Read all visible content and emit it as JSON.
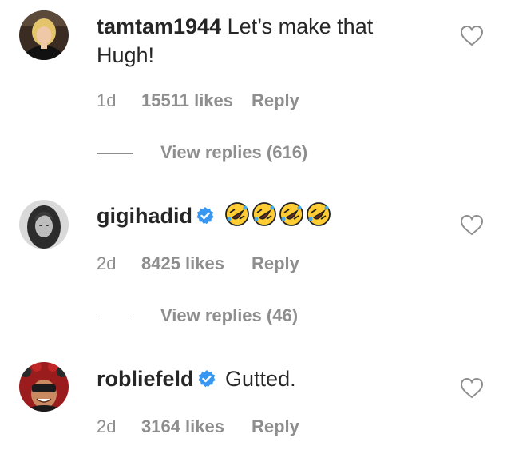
{
  "colors": {
    "text": "#262626",
    "muted": "#8e8e8e",
    "verified": "#3897f0"
  },
  "comments": [
    {
      "username": "tamtam1944",
      "text_line1": "Let’s make that",
      "text_line2": "Hugh!",
      "verified": false,
      "time": "1d",
      "likes": "15511 likes",
      "reply": "Reply",
      "view_replies": "View replies (616)",
      "avatar_icon": "avatar-woman-blonde"
    },
    {
      "username": "gigihadid",
      "text": "🤣🤣🤣🤣",
      "verified": true,
      "time": "2d",
      "likes": "8425 likes",
      "reply": "Reply",
      "view_replies": "View replies (46)",
      "avatar_icon": "avatar-woman-bw"
    },
    {
      "username": "robliefeld",
      "text": "Gutted.",
      "verified": true,
      "time": "2d",
      "likes": "3164 likes",
      "reply": "Reply",
      "avatar_icon": "avatar-man-red-background"
    }
  ],
  "icons": {
    "like": "heart-outline-icon",
    "verified": "verified-badge-icon",
    "emoji": "rolling-on-floor-laughing-emoji"
  }
}
